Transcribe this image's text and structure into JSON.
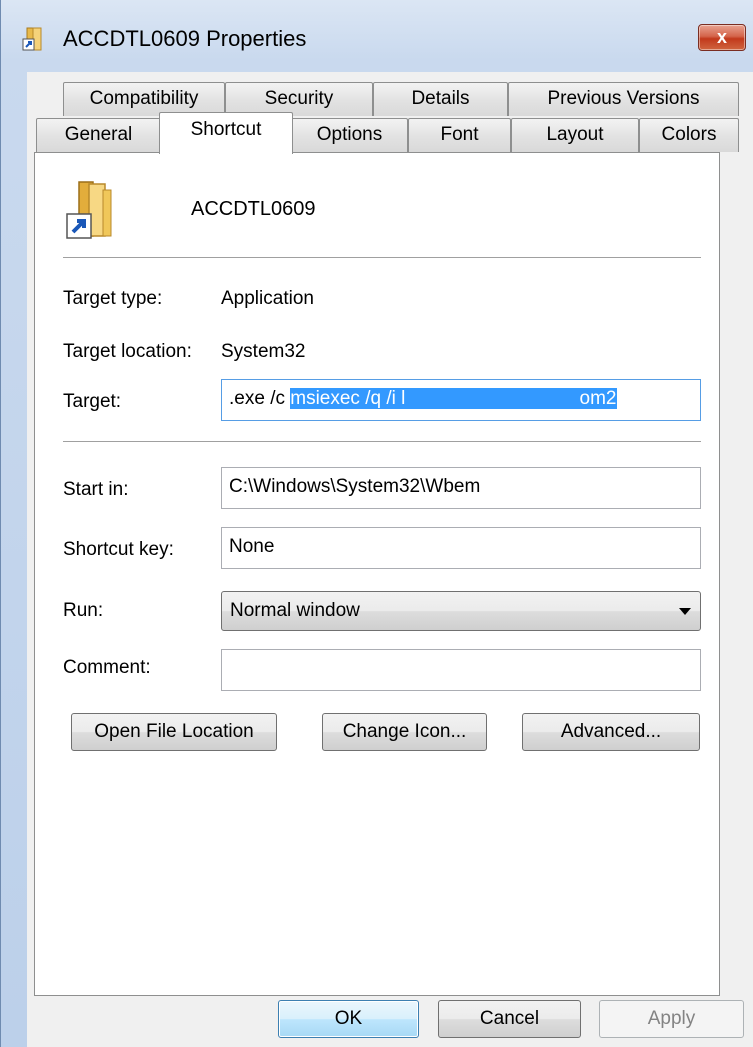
{
  "window": {
    "title": "ACCDTL0609 Properties",
    "close_label": "x"
  },
  "tabs_back": [
    {
      "label": "Compatibility"
    },
    {
      "label": "Security"
    },
    {
      "label": "Details"
    },
    {
      "label": "Previous Versions"
    }
  ],
  "tabs_front": [
    {
      "label": "General"
    },
    {
      "label": "Shortcut"
    },
    {
      "label": "Options"
    },
    {
      "label": "Font"
    },
    {
      "label": "Layout"
    },
    {
      "label": "Colors"
    }
  ],
  "shortcut": {
    "name": "ACCDTL0609",
    "target_type_label": "Target type:",
    "target_type_value": "Application",
    "target_location_label": "Target location:",
    "target_location_value": "System32",
    "target_label": "Target:",
    "target_value_prefix": ".exe /c ",
    "target_value_selected": "msiexec /q /i l                                 om2",
    "start_in_label": "Start in:",
    "start_in_value": "C:\\Windows\\System32\\Wbem",
    "shortcut_key_label": "Shortcut key:",
    "shortcut_key_value": "None",
    "run_label": "Run:",
    "run_value": "Normal window",
    "comment_label": "Comment:",
    "comment_value": ""
  },
  "buttons": {
    "open_file_location": "Open File Location",
    "change_icon": "Change Icon...",
    "advanced": "Advanced...",
    "ok": "OK",
    "cancel": "Cancel",
    "apply": "Apply"
  }
}
